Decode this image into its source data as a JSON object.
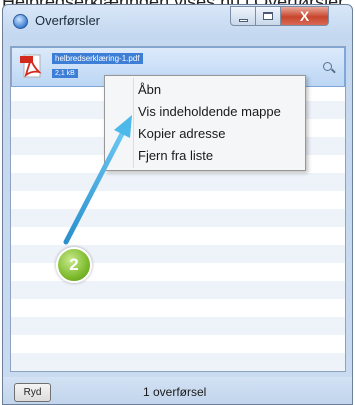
{
  "caption": "Helbredserklæringen vises nu i Overførsler",
  "window": {
    "title": "Overførsler",
    "close_label": "X"
  },
  "download": {
    "file_name": "helbredserklæring-1.pdf",
    "file_size": "2,1 kB",
    "icon": "pdf-icon"
  },
  "context_menu": {
    "items": [
      {
        "label": "Åbn"
      },
      {
        "label": "Vis indeholdende mappe"
      },
      {
        "label": "Kopier adresse"
      },
      {
        "label": "Fjern fra liste"
      }
    ]
  },
  "annotation": {
    "step_number": "2",
    "color": "#7dbb2d",
    "arrow_color": "#3aa8e0"
  },
  "statusbar": {
    "clear_label": "Ryd",
    "status_text": "1 overførsel"
  }
}
